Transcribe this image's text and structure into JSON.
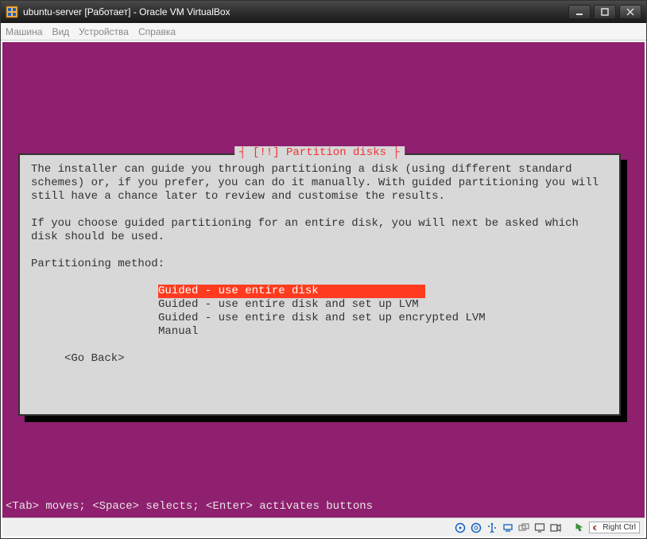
{
  "window": {
    "title": "ubuntu-server [Работает] - Oracle VM VirtualBox"
  },
  "menubar": {
    "items": [
      "Машина",
      "Вид",
      "Устройства",
      "Справка"
    ]
  },
  "dialog": {
    "title": "[!!] Partition disks",
    "para1": "The installer can guide you through partitioning a disk (using different standard schemes) or, if you prefer, you can do it manually. With guided partitioning you will still have a chance later to review and customise the results.",
    "para2": "If you choose guided partitioning for an entire disk, you will next be asked which disk should be used.",
    "prompt": "Partitioning method:",
    "options": [
      "Guided - use entire disk",
      "Guided - use entire disk and set up LVM",
      "Guided - use entire disk and set up encrypted LVM",
      "Manual"
    ],
    "go_back": "<Go Back>"
  },
  "footer_hint": "<Tab> moves; <Space> selects; <Enter> activates buttons",
  "statusbar": {
    "host_key": "Right Ctrl"
  }
}
